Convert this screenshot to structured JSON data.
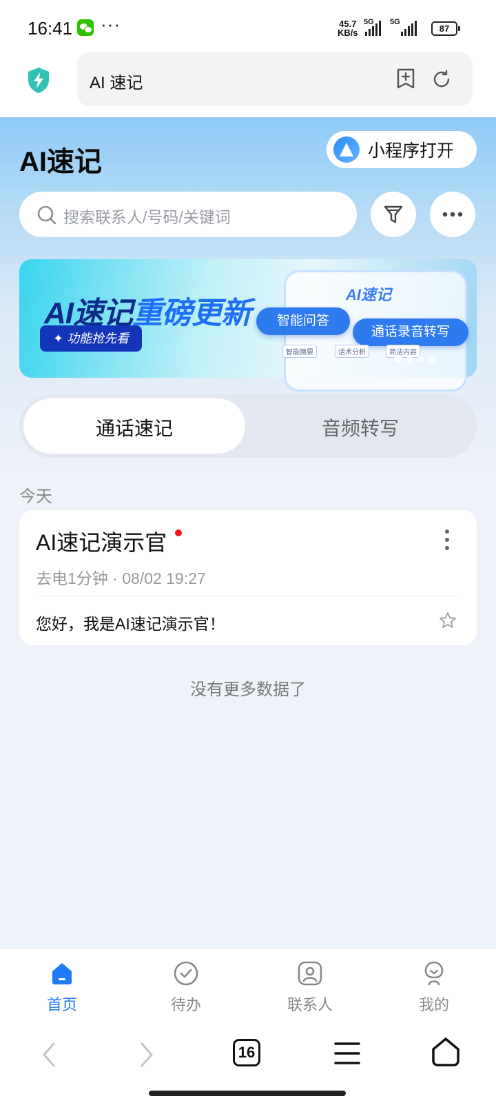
{
  "status_bar": {
    "time": "16:41",
    "more": "···",
    "net_speed_value": "45.7",
    "net_speed_unit": "KB/s",
    "sim1": "5G",
    "sim2": "5G",
    "battery": "87"
  },
  "browser": {
    "url_title": "AI 速记",
    "icons": {
      "security": "shield-bolt-icon",
      "bookmark": "bookmark-add-icon",
      "reload": "reload-icon"
    }
  },
  "header": {
    "title": "AI速记",
    "mini_program_button": "小程序打开"
  },
  "search": {
    "placeholder": "搜索联系人/号码/关键词"
  },
  "banner": {
    "title_part1": "AI速记",
    "title_part2": "重磅更新",
    "tag": "✦ 功能抢先看",
    "phone_title": "AI速记",
    "pill1": "智能问答",
    "pill2": "通话录音转写",
    "chip1": "智能摘要",
    "chip2": "话术分析",
    "chip3": "简洁内容",
    "slide_index": 1,
    "slide_count": 4
  },
  "tabs": {
    "items": [
      {
        "label": "通话速记",
        "selected": true
      },
      {
        "label": "音频转写",
        "selected": false
      }
    ]
  },
  "list": {
    "section_label": "今天",
    "items": [
      {
        "title": "AI速记演示官",
        "unread": true,
        "meta": "去电1分钟  ·  08/02 19:27",
        "preview": "您好，我是AI速记演示官！",
        "starred": false
      }
    ],
    "end_text": "没有更多数据了"
  },
  "bottom_nav": {
    "items": [
      {
        "label": "首页",
        "icon": "home-icon",
        "active": true
      },
      {
        "label": "待办",
        "icon": "check-circle-icon",
        "active": false
      },
      {
        "label": "联系人",
        "icon": "contact-icon",
        "active": false
      },
      {
        "label": "我的",
        "icon": "profile-icon",
        "active": false
      }
    ]
  },
  "browser_nav": {
    "tab_count": "16"
  },
  "colors": {
    "accent": "#1e7bf2",
    "unread_dot": "#f0171c",
    "banner_dark": "#0b2a8a"
  }
}
